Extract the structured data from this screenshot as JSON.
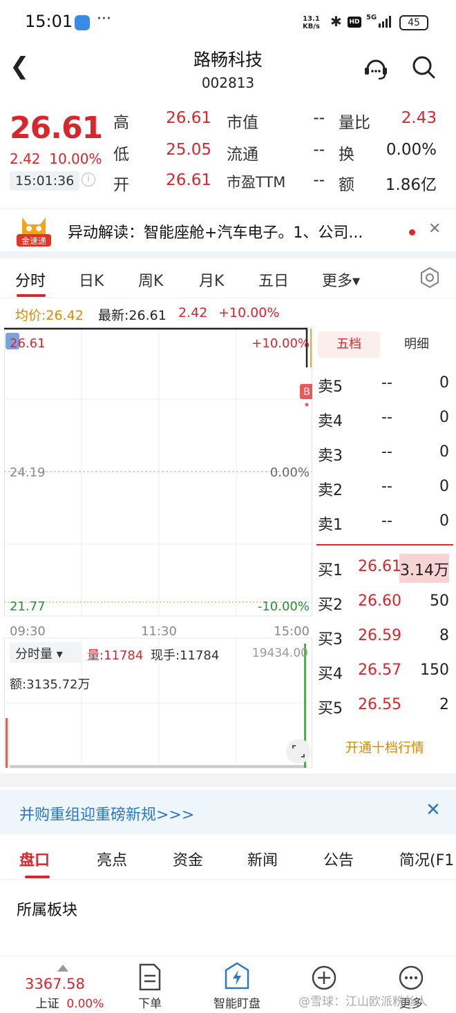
{
  "status_bar": {
    "time": "15:01",
    "dots": "···",
    "net_speed": "13.1",
    "net_unit": "KB/s",
    "hd": "HD",
    "signal": "5G",
    "battery": "45"
  },
  "header": {
    "stock_name": "路畅科技",
    "stock_code": "002813"
  },
  "quote": {
    "price": "26.61",
    "change": "2.42",
    "change_pct": "10.00%",
    "time": "15:01:36",
    "info_glyph": "i",
    "fields": [
      {
        "label": "高",
        "value": "26.61"
      },
      {
        "label": "市值",
        "value": "--"
      },
      {
        "label": "量比",
        "value": "2.43"
      },
      {
        "label": "低",
        "value": "25.05"
      },
      {
        "label": "流通",
        "value": "--"
      },
      {
        "label": "换",
        "value": "0.00%"
      },
      {
        "label": "开",
        "value": "26.61"
      },
      {
        "label": "市盈TTM",
        "value": "--"
      },
      {
        "label": "额",
        "value": "1.86亿"
      }
    ]
  },
  "news": {
    "logo_text": "金速递",
    "text": "异动解读：智能座舱+汽车电子。1、公司..."
  },
  "chart_tabs": [
    "分时",
    "日K",
    "周K",
    "月K",
    "五日",
    "更多▾"
  ],
  "info_line": {
    "avg": "均价:26.42",
    "latest": "最新:26.61",
    "change": "2.42",
    "pct": "+10.00%"
  },
  "chart_data": {
    "type": "line",
    "price_axis": {
      "top": "26.61",
      "mid": "24.19",
      "bottom": "21.77"
    },
    "pct_axis": {
      "top": "+10.00%",
      "mid": "0.00%",
      "bottom": "-10.00%"
    },
    "x_ticks": [
      "09:30",
      "11:30",
      "15:00"
    ],
    "marker": "B",
    "volume_selector": "分时量 ▾",
    "volume": "量:11784",
    "current_hand": "现手:11784",
    "volume_max": "19434.00",
    "amount": "额:3135.72万"
  },
  "order_book": {
    "tabs": [
      "五档",
      "明细"
    ],
    "asks": [
      {
        "label": "卖5",
        "price": "--",
        "vol": "0"
      },
      {
        "label": "卖4",
        "price": "--",
        "vol": "0"
      },
      {
        "label": "卖3",
        "price": "--",
        "vol": "0"
      },
      {
        "label": "卖2",
        "price": "--",
        "vol": "0"
      },
      {
        "label": "卖1",
        "price": "--",
        "vol": "0"
      }
    ],
    "bids": [
      {
        "label": "买1",
        "price": "26.61",
        "vol": "3.14万"
      },
      {
        "label": "买2",
        "price": "26.60",
        "vol": "50"
      },
      {
        "label": "买3",
        "price": "26.59",
        "vol": "8"
      },
      {
        "label": "买4",
        "price": "26.57",
        "vol": "150"
      },
      {
        "label": "买5",
        "price": "26.55",
        "vol": "2"
      }
    ],
    "more": "开通十档行情"
  },
  "promo": {
    "text": "并购重组迎重磅新规>>>"
  },
  "bottom_tabs": [
    "盘口",
    "亮点",
    "资金",
    "新闻",
    "公告",
    "简况(F1"
  ],
  "section_title": "所属板块",
  "nav": {
    "index_value": "3367.58",
    "index_name": "上证",
    "index_pct": "0.00%",
    "order": "下单",
    "smart": "智能盯盘",
    "more": "更多"
  },
  "watermark": "@雪球：江山欧派粉丝人",
  "colors": {
    "up": "#d8262d",
    "accent": "#d98a00",
    "link": "#2b78c2"
  }
}
